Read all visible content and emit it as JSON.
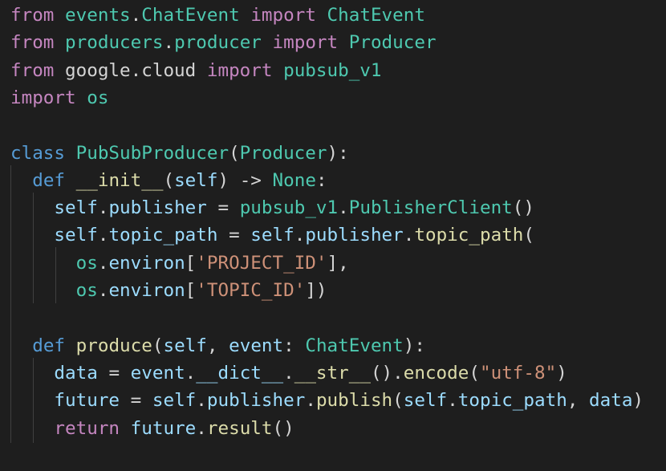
{
  "code": {
    "lines": [
      [
        {
          "t": "from",
          "c": "kw-ctrl"
        },
        {
          "t": " ",
          "c": "plain"
        },
        {
          "t": "events",
          "c": "cls"
        },
        {
          "t": ".",
          "c": "plain"
        },
        {
          "t": "ChatEvent",
          "c": "cls"
        },
        {
          "t": " ",
          "c": "plain"
        },
        {
          "t": "import",
          "c": "kw-ctrl"
        },
        {
          "t": " ",
          "c": "plain"
        },
        {
          "t": "ChatEvent",
          "c": "cls"
        }
      ],
      [
        {
          "t": "from",
          "c": "kw-ctrl"
        },
        {
          "t": " ",
          "c": "plain"
        },
        {
          "t": "producers",
          "c": "cls"
        },
        {
          "t": ".",
          "c": "plain"
        },
        {
          "t": "producer",
          "c": "cls"
        },
        {
          "t": " ",
          "c": "plain"
        },
        {
          "t": "import",
          "c": "kw-ctrl"
        },
        {
          "t": " ",
          "c": "plain"
        },
        {
          "t": "Producer",
          "c": "cls"
        }
      ],
      [
        {
          "t": "from",
          "c": "kw-ctrl"
        },
        {
          "t": " google.cloud ",
          "c": "plain"
        },
        {
          "t": "import",
          "c": "kw-ctrl"
        },
        {
          "t": " ",
          "c": "plain"
        },
        {
          "t": "pubsub_v1",
          "c": "cls"
        }
      ],
      [
        {
          "t": "import",
          "c": "kw-ctrl"
        },
        {
          "t": " ",
          "c": "plain"
        },
        {
          "t": "os",
          "c": "cls"
        }
      ],
      [],
      [
        {
          "t": "class",
          "c": "kw"
        },
        {
          "t": " ",
          "c": "plain"
        },
        {
          "t": "PubSubProducer",
          "c": "cls"
        },
        {
          "t": "(",
          "c": "plain"
        },
        {
          "t": "Producer",
          "c": "cls"
        },
        {
          "t": "):",
          "c": "plain"
        }
      ],
      [
        {
          "t": "  ",
          "c": "plain"
        },
        {
          "t": "def",
          "c": "kw"
        },
        {
          "t": " ",
          "c": "plain"
        },
        {
          "t": "__init__",
          "c": "fn"
        },
        {
          "t": "(",
          "c": "plain"
        },
        {
          "t": "self",
          "c": "var"
        },
        {
          "t": ") -> ",
          "c": "plain"
        },
        {
          "t": "None",
          "c": "cls"
        },
        {
          "t": ":",
          "c": "plain"
        }
      ],
      [
        {
          "t": "    ",
          "c": "plain"
        },
        {
          "t": "self",
          "c": "var"
        },
        {
          "t": ".",
          "c": "plain"
        },
        {
          "t": "publisher",
          "c": "var"
        },
        {
          "t": " = ",
          "c": "plain"
        },
        {
          "t": "pubsub_v1",
          "c": "cls"
        },
        {
          "t": ".",
          "c": "plain"
        },
        {
          "t": "PublisherClient",
          "c": "cls"
        },
        {
          "t": "()",
          "c": "plain"
        }
      ],
      [
        {
          "t": "    ",
          "c": "plain"
        },
        {
          "t": "self",
          "c": "var"
        },
        {
          "t": ".",
          "c": "plain"
        },
        {
          "t": "topic_path",
          "c": "var"
        },
        {
          "t": " = ",
          "c": "plain"
        },
        {
          "t": "self",
          "c": "var"
        },
        {
          "t": ".",
          "c": "plain"
        },
        {
          "t": "publisher",
          "c": "var"
        },
        {
          "t": ".",
          "c": "plain"
        },
        {
          "t": "topic_path",
          "c": "fn"
        },
        {
          "t": "(",
          "c": "plain"
        }
      ],
      [
        {
          "t": "      ",
          "c": "plain"
        },
        {
          "t": "os",
          "c": "cls"
        },
        {
          "t": ".",
          "c": "plain"
        },
        {
          "t": "environ",
          "c": "var"
        },
        {
          "t": "[",
          "c": "plain"
        },
        {
          "t": "'PROJECT_ID'",
          "c": "str"
        },
        {
          "t": "],",
          "c": "plain"
        }
      ],
      [
        {
          "t": "      ",
          "c": "plain"
        },
        {
          "t": "os",
          "c": "cls"
        },
        {
          "t": ".",
          "c": "plain"
        },
        {
          "t": "environ",
          "c": "var"
        },
        {
          "t": "[",
          "c": "plain"
        },
        {
          "t": "'TOPIC_ID'",
          "c": "str"
        },
        {
          "t": "])",
          "c": "plain"
        }
      ],
      [],
      [
        {
          "t": "  ",
          "c": "plain"
        },
        {
          "t": "def",
          "c": "kw"
        },
        {
          "t": " ",
          "c": "plain"
        },
        {
          "t": "produce",
          "c": "fn"
        },
        {
          "t": "(",
          "c": "plain"
        },
        {
          "t": "self",
          "c": "var"
        },
        {
          "t": ", ",
          "c": "plain"
        },
        {
          "t": "event",
          "c": "var"
        },
        {
          "t": ": ",
          "c": "plain"
        },
        {
          "t": "ChatEvent",
          "c": "cls"
        },
        {
          "t": "):",
          "c": "plain"
        }
      ],
      [
        {
          "t": "    ",
          "c": "plain"
        },
        {
          "t": "data",
          "c": "var"
        },
        {
          "t": " = ",
          "c": "plain"
        },
        {
          "t": "event",
          "c": "var"
        },
        {
          "t": ".",
          "c": "plain"
        },
        {
          "t": "__dict__",
          "c": "var"
        },
        {
          "t": ".",
          "c": "plain"
        },
        {
          "t": "__str__",
          "c": "fn"
        },
        {
          "t": "().",
          "c": "plain"
        },
        {
          "t": "encode",
          "c": "fn"
        },
        {
          "t": "(",
          "c": "plain"
        },
        {
          "t": "\"utf-8\"",
          "c": "str"
        },
        {
          "t": ")",
          "c": "plain"
        }
      ],
      [
        {
          "t": "    ",
          "c": "plain"
        },
        {
          "t": "future",
          "c": "var"
        },
        {
          "t": " = ",
          "c": "plain"
        },
        {
          "t": "self",
          "c": "var"
        },
        {
          "t": ".",
          "c": "plain"
        },
        {
          "t": "publisher",
          "c": "var"
        },
        {
          "t": ".",
          "c": "plain"
        },
        {
          "t": "publish",
          "c": "fn"
        },
        {
          "t": "(",
          "c": "plain"
        },
        {
          "t": "self",
          "c": "var"
        },
        {
          "t": ".",
          "c": "plain"
        },
        {
          "t": "topic_path",
          "c": "var"
        },
        {
          "t": ", ",
          "c": "plain"
        },
        {
          "t": "data",
          "c": "var"
        },
        {
          "t": ")",
          "c": "plain"
        }
      ],
      [
        {
          "t": "    ",
          "c": "plain"
        },
        {
          "t": "return",
          "c": "kw-ctrl"
        },
        {
          "t": " ",
          "c": "plain"
        },
        {
          "t": "future",
          "c": "var"
        },
        {
          "t": ".",
          "c": "plain"
        },
        {
          "t": "result",
          "c": "fn"
        },
        {
          "t": "()",
          "c": "plain"
        }
      ]
    ]
  },
  "colors": {
    "background": "#1e1e1e",
    "keyword_control": "#c586c0",
    "keyword": "#569cd6",
    "class": "#4ec9b0",
    "function": "#dcdcaa",
    "variable": "#9cdcfe",
    "string": "#ce9178",
    "default": "#d4d4d4",
    "indent_guide": "#404040"
  }
}
